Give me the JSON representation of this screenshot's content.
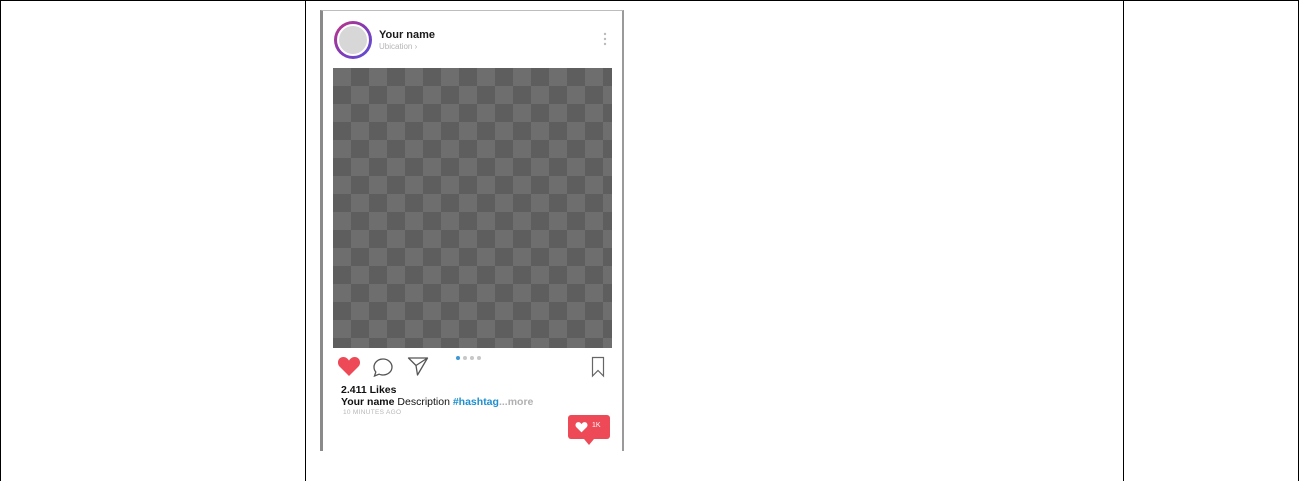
{
  "post": {
    "username": "Your name",
    "location": "Ubication ›",
    "likes": "2.411 Likes",
    "caption_name": "Your name",
    "caption_text": " Description ",
    "caption_hashtag": "#hashtag",
    "caption_more": "...more",
    "timestamp": "10 MINUTES AGO",
    "notification_count": "1K",
    "carousel_active_index": 0,
    "carousel_count": 4
  },
  "colors": {
    "like_red": "#ed4956",
    "hashtag_blue": "#1e8fcf",
    "dot_active": "#3b99d4",
    "avatar_ring": "#833ab4"
  },
  "icons": {
    "like": "heart-icon",
    "comment": "comment-icon",
    "share": "share-icon",
    "save": "bookmark-icon",
    "menu": "more-vertical-icon"
  }
}
